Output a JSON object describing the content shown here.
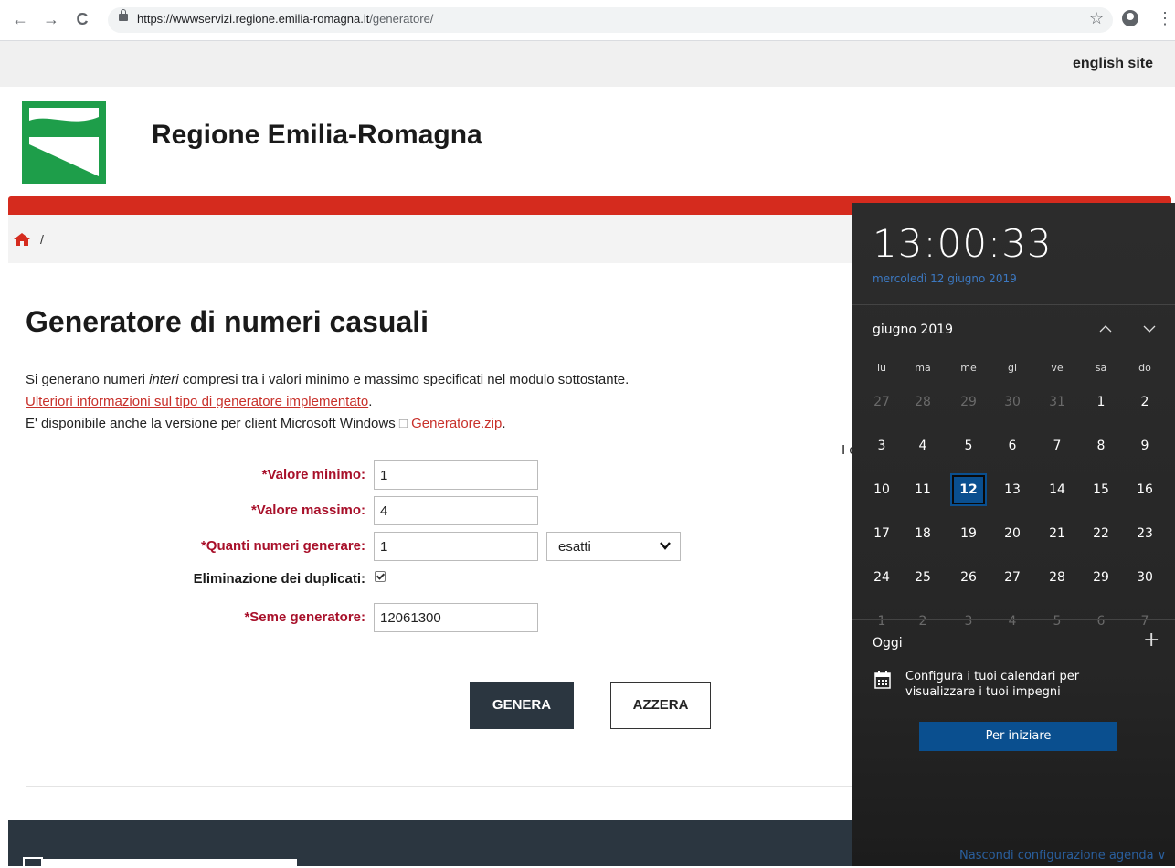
{
  "browser": {
    "back_icon": "←",
    "forward_icon": "→",
    "reload_icon": "C",
    "url_host": "https://wwwservizi.regione.emilia-romagna.it",
    "url_path": "/generatore/",
    "star_icon": "☆",
    "menu_icon": "⋮"
  },
  "header": {
    "english_link": "english site",
    "site_title": "Regione Emilia-Romagna",
    "breadcrumb_sep": "/"
  },
  "main": {
    "title": "Generatore di numeri casuali",
    "intro_before": "Si generano numeri ",
    "intro_em": "interi",
    "intro_after": " compresi tra i valori minimo e massimo specificati nel modulo sottostante.",
    "info_link": "Ulteriori informazioni sul tipo di generatore implementato",
    "info_link_after": ".",
    "windows_text": "E' disponibile anche la versione per client Microsoft Windows",
    "windows_glyph": "□",
    "zip_link": "Generatore.zip",
    "zip_after": ".",
    "stray_text": "I c"
  },
  "form": {
    "min_label": "*Valore minimo:",
    "min_value": "1",
    "max_label": "*Valore massimo:",
    "max_value": "4",
    "count_label": "*Quanti numeri generare:",
    "count_value": "1",
    "count_mode": "esatti",
    "dedupe_label": "Eliminazione dei duplicati:",
    "dedupe_checked": true,
    "seed_label": "*Seme generatore:",
    "seed_value": "12061300",
    "genera_label": "GENERA",
    "azzera_label": "AZZERA"
  },
  "flyout": {
    "time": "13:00:33",
    "date_long": "mercoledì 12 giugno 2019",
    "month_label": "giugno 2019",
    "weekdays": [
      "lu",
      "ma",
      "me",
      "gi",
      "ve",
      "sa",
      "do"
    ],
    "weeks": [
      [
        {
          "d": "27",
          "dim": true
        },
        {
          "d": "28",
          "dim": true
        },
        {
          "d": "29",
          "dim": true
        },
        {
          "d": "30",
          "dim": true
        },
        {
          "d": "31",
          "dim": true
        },
        {
          "d": "1"
        },
        {
          "d": "2"
        }
      ],
      [
        {
          "d": "3"
        },
        {
          "d": "4"
        },
        {
          "d": "5"
        },
        {
          "d": "6"
        },
        {
          "d": "7"
        },
        {
          "d": "8"
        },
        {
          "d": "9"
        }
      ],
      [
        {
          "d": "10"
        },
        {
          "d": "11"
        },
        {
          "d": "12",
          "today": true
        },
        {
          "d": "13"
        },
        {
          "d": "14"
        },
        {
          "d": "15"
        },
        {
          "d": "16"
        }
      ],
      [
        {
          "d": "17"
        },
        {
          "d": "18"
        },
        {
          "d": "19"
        },
        {
          "d": "20"
        },
        {
          "d": "21"
        },
        {
          "d": "22"
        },
        {
          "d": "23"
        }
      ],
      [
        {
          "d": "24"
        },
        {
          "d": "25"
        },
        {
          "d": "26"
        },
        {
          "d": "27"
        },
        {
          "d": "28"
        },
        {
          "d": "29"
        },
        {
          "d": "30"
        }
      ],
      [
        {
          "d": "1",
          "dim": true
        },
        {
          "d": "2",
          "dim": true
        },
        {
          "d": "3",
          "dim": true
        },
        {
          "d": "4",
          "dim": true
        },
        {
          "d": "5",
          "dim": true
        },
        {
          "d": "6",
          "dim": true
        },
        {
          "d": "7",
          "dim": true
        }
      ]
    ],
    "today_label": "Oggi",
    "plus_icon": "+",
    "config_text": "Configura i tuoi calendari per visualizzare i tuoi impegni",
    "start_button": "Per iniziare",
    "hide_link": "Nascondi configurazione agenda",
    "hide_chevron": "∨"
  },
  "colors": {
    "brand_red": "#d52b1e",
    "label_red": "#a8102a",
    "logo_green": "#1e9e4a",
    "dark_button": "#2b3640",
    "today_blue": "#0a4f8f"
  }
}
